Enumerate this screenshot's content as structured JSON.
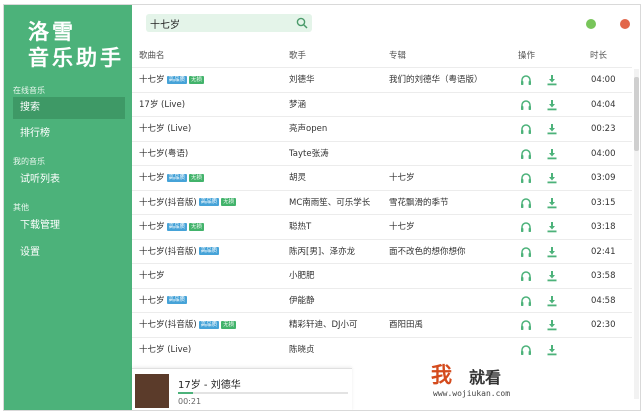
{
  "app": {
    "logo_line1": "洛雪",
    "logo_line2": "音乐助手",
    "window_dots": {
      "green": "#78c55a",
      "red": "#e2664a"
    }
  },
  "sidebar": {
    "section_online": "在线音乐",
    "item_search": "搜索",
    "item_charts": "排行榜",
    "section_mine": "我的音乐",
    "item_trial_list": "试听列表",
    "section_other": "其他",
    "item_download": "下载管理",
    "item_settings": "设置"
  },
  "search": {
    "value": "十七岁",
    "icon": "search-icon"
  },
  "table": {
    "headers": {
      "song": "歌曲名",
      "artist": "歌手",
      "album": "专辑",
      "ops": "操作",
      "duration": "时长"
    },
    "rows": [
      {
        "song": "十七岁",
        "hq": "高品质",
        "ls": "无损",
        "artist": "刘德华",
        "album": "我们的刘德华（粤语版）",
        "duration": "04:00"
      },
      {
        "song": "17岁 (Live)",
        "hq": "",
        "ls": "",
        "artist": "梦涵",
        "album": "",
        "duration": "04:04"
      },
      {
        "song": "十七岁 (Live)",
        "hq": "",
        "ls": "",
        "artist": "亮声open",
        "album": "",
        "duration": "00:23"
      },
      {
        "song": "十七岁(粤语)",
        "hq": "",
        "ls": "",
        "artist": "Tayte张涛",
        "album": "",
        "duration": "04:00"
      },
      {
        "song": "十七岁",
        "hq": "高品质",
        "ls": "无损",
        "artist": "胡灵",
        "album": "十七岁",
        "duration": "03:09"
      },
      {
        "song": "十七岁(抖音版)",
        "hq": "高品质",
        "ls": "无损",
        "artist": "MC南雨笙、可乐学长",
        "album": "雪花飘滑的季节",
        "duration": "03:15"
      },
      {
        "song": "十七岁",
        "hq": "高品质",
        "ls": "无损",
        "artist": "聪热T",
        "album": "十七岁",
        "duration": "03:18"
      },
      {
        "song": "十七岁(抖音版)",
        "hq": "高品质",
        "ls": "",
        "artist": "陈丙[男]、泽亦龙",
        "album": "面不改色的想你想你",
        "duration": "02:41"
      },
      {
        "song": "十七岁",
        "hq": "",
        "ls": "",
        "artist": "小肥肥",
        "album": "",
        "duration": "03:58"
      },
      {
        "song": "十七岁",
        "hq": "高品质",
        "ls": "",
        "artist": "伊能静",
        "album": "",
        "duration": "04:58"
      },
      {
        "song": "十七岁(抖音版)",
        "hq": "高品质",
        "ls": "无损",
        "artist": "精彩轩迪、DJ小可",
        "album": "酉阳田禹",
        "duration": "02:30"
      },
      {
        "song": "十七岁 (Live)",
        "hq": "",
        "ls": "",
        "artist": "陈晓贞",
        "album": "",
        "duration": ""
      }
    ]
  },
  "player": {
    "title": "17岁 - 刘德华",
    "time": "00:21",
    "progress": 0.09
  },
  "watermark": {
    "word1": "我",
    "word2": "就看",
    "url": "www.wojiukan.com"
  }
}
